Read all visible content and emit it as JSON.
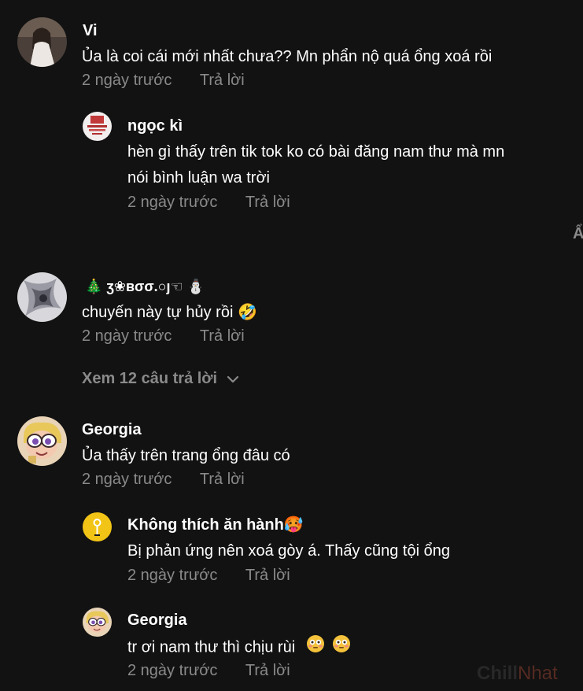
{
  "comments": [
    {
      "user": "Vi",
      "text": "Ủa là coi cái mới nhất chưa?? Mn phẩn nộ quá ổng xoá rồi",
      "time": "2 ngày trước",
      "reply": "Trả lời"
    },
    {
      "user": "ngọc kì",
      "text_line1": "hèn gì thấy trên tik tok ko có bài đăng nam thư mà mn",
      "text_line2": "nói bình luận wa trời",
      "time": "2 ngày trước",
      "reply": "Trả lời"
    },
    {
      "user": "🎄 ʒ❀ʙσσ.○ȷ☜ ⛄",
      "text": "chuyến này tự hủy rồi 🤣",
      "time": "2 ngày trước",
      "reply": "Trả lời",
      "view_replies": "Xem 12 câu trả lời"
    },
    {
      "user": "Georgia",
      "text": "Ủa thấy trên trang ổng đâu có",
      "time": "2 ngày trước",
      "reply": "Trả lời"
    },
    {
      "user": "Không thích ăn hành🥵",
      "text": "Bị phản ứng nên xoá gòy á. Thấy cũng tội ổng",
      "time": "2 ngày trước",
      "reply": "Trả lời"
    },
    {
      "user": "Georgia",
      "text": "tr ơi nam thư thì chịu rùi",
      "time": "2 ngày trước",
      "reply": "Trả lời"
    }
  ],
  "edge_text": "Ẩ",
  "watermark": {
    "part1": "Chill",
    "part2": "Nhat"
  },
  "icons": {
    "chevron": "chevron-down-icon",
    "emoji_flushed": "flushed-face-emoji"
  },
  "colors": {
    "background": "#121212",
    "text": "#ffffff",
    "muted": "#8a8a8a"
  }
}
